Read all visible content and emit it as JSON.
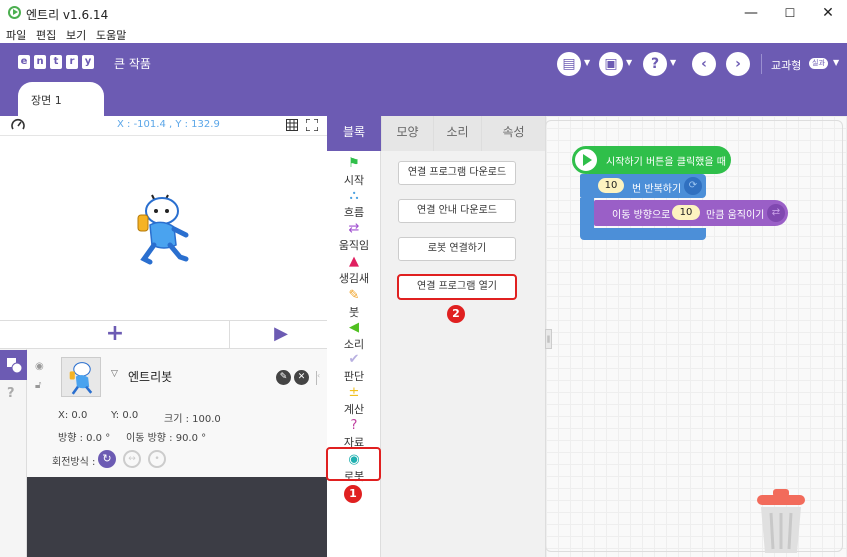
{
  "window": {
    "title": "엔트리 v1.6.14",
    "min": "—",
    "max": "☐",
    "close": "✕"
  },
  "menu": [
    "파일",
    "편집",
    "보기",
    "도움말"
  ],
  "header": {
    "logo_letters": [
      "e",
      "n",
      "t",
      "r",
      "y"
    ],
    "project_title": "큰 작품",
    "user_label": "교과형",
    "user_badge": "실과",
    "scene_tab": "장면 1"
  },
  "stage": {
    "coord_text": "X : -101.4 , Y : 132.9",
    "add_label": "+",
    "play_label": "▶"
  },
  "object": {
    "name": "엔트리봇",
    "x_label": "X: 0.0",
    "y_label": "Y: 0.0",
    "size_label": "크기 : 100.0",
    "direction_label": "방향 : 0.0 °",
    "move_direction_label": "이동 방향 : 90.0 °",
    "rotation_label": "회전방식 :"
  },
  "tabs": [
    "블록",
    "모양",
    "소리",
    "속성"
  ],
  "categories": [
    {
      "label": "시작",
      "icon": "flag-icon",
      "glyph": "⚑",
      "color": "#2fbf4a"
    },
    {
      "label": "흐름",
      "icon": "flow-icon",
      "glyph": "⛬",
      "color": "#4aa0e0"
    },
    {
      "label": "움직임",
      "icon": "arrows-icon",
      "glyph": "⇄",
      "color": "#a050d0"
    },
    {
      "label": "생김새",
      "icon": "shapes-icon",
      "glyph": "▲",
      "color": "#e02060"
    },
    {
      "label": "붓",
      "icon": "brush-icon",
      "glyph": "✎",
      "color": "#f0a020"
    },
    {
      "label": "소리",
      "icon": "speaker-icon",
      "glyph": "◀",
      "color": "#50c020"
    },
    {
      "label": "판단",
      "icon": "check-icon",
      "glyph": "✔",
      "color": "#7060c0"
    },
    {
      "label": "계산",
      "icon": "calc-icon",
      "glyph": "±",
      "color": "#f0c020"
    },
    {
      "label": "자료",
      "icon": "question-icon",
      "glyph": "?",
      "color": "#c040a0"
    },
    {
      "label": "로봇",
      "icon": "robot-icon",
      "glyph": "◉",
      "color": "#20b0b0"
    }
  ],
  "palette_buttons": [
    "연결 프로그램 다운로드",
    "연결 안내 다운로드",
    "로봇 연결하기",
    "연결 프로그램 열기"
  ],
  "badges": [
    "1",
    "2"
  ],
  "blocks": {
    "start": "시작하기 버튼을 클릭했을 때",
    "repeat_count": "10",
    "repeat_label": "번 반복하기",
    "move_prefix": "이동 방향으로",
    "move_value": "10",
    "move_suffix": "만큼 움직이기"
  }
}
